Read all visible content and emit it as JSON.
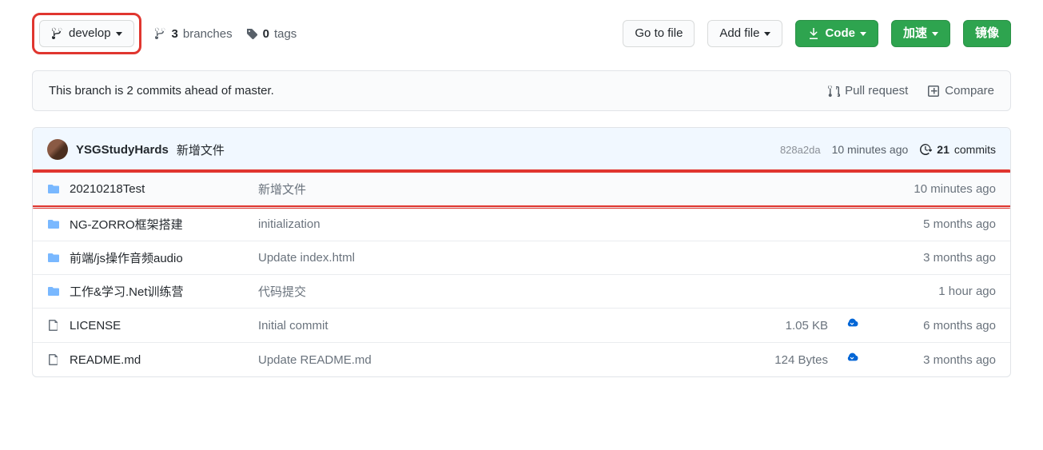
{
  "toolbar": {
    "branch_label": "develop",
    "branches_count": "3",
    "branches_text": "branches",
    "tags_count": "0",
    "tags_text": "tags",
    "go_to_file": "Go to file",
    "add_file": "Add file",
    "code": "Code",
    "accelerate": "加速",
    "mirror": "镜像"
  },
  "notice": {
    "text": "This branch is 2 commits ahead of master.",
    "pull_request": "Pull request",
    "compare": "Compare"
  },
  "header": {
    "author": "YSGStudyHards",
    "message": "新增文件",
    "sha": "828a2da",
    "time": "10 minutes ago",
    "commits_count": "21",
    "commits_text": "commits"
  },
  "files": [
    {
      "type": "folder",
      "name": "20210218Test",
      "message": "新增文件",
      "size": "",
      "lfs": false,
      "time": "10 minutes ago",
      "highlight": true
    },
    {
      "type": "folder",
      "name": "NG-ZORRO框架搭建",
      "message": "initialization",
      "size": "",
      "lfs": false,
      "time": "5 months ago",
      "highlight": false
    },
    {
      "type": "folder",
      "name": "前端/js操作音频audio",
      "message": "Update index.html",
      "size": "",
      "lfs": false,
      "time": "3 months ago",
      "highlight": false
    },
    {
      "type": "folder",
      "name": "工作&学习.Net训练营",
      "message": "代码提交",
      "size": "",
      "lfs": false,
      "time": "1 hour ago",
      "highlight": false
    },
    {
      "type": "file",
      "name": "LICENSE",
      "message": "Initial commit",
      "size": "1.05 KB",
      "lfs": true,
      "time": "6 months ago",
      "highlight": false
    },
    {
      "type": "file",
      "name": "README.md",
      "message": "Update README.md",
      "size": "124 Bytes",
      "lfs": true,
      "time": "3 months ago",
      "highlight": false
    }
  ]
}
